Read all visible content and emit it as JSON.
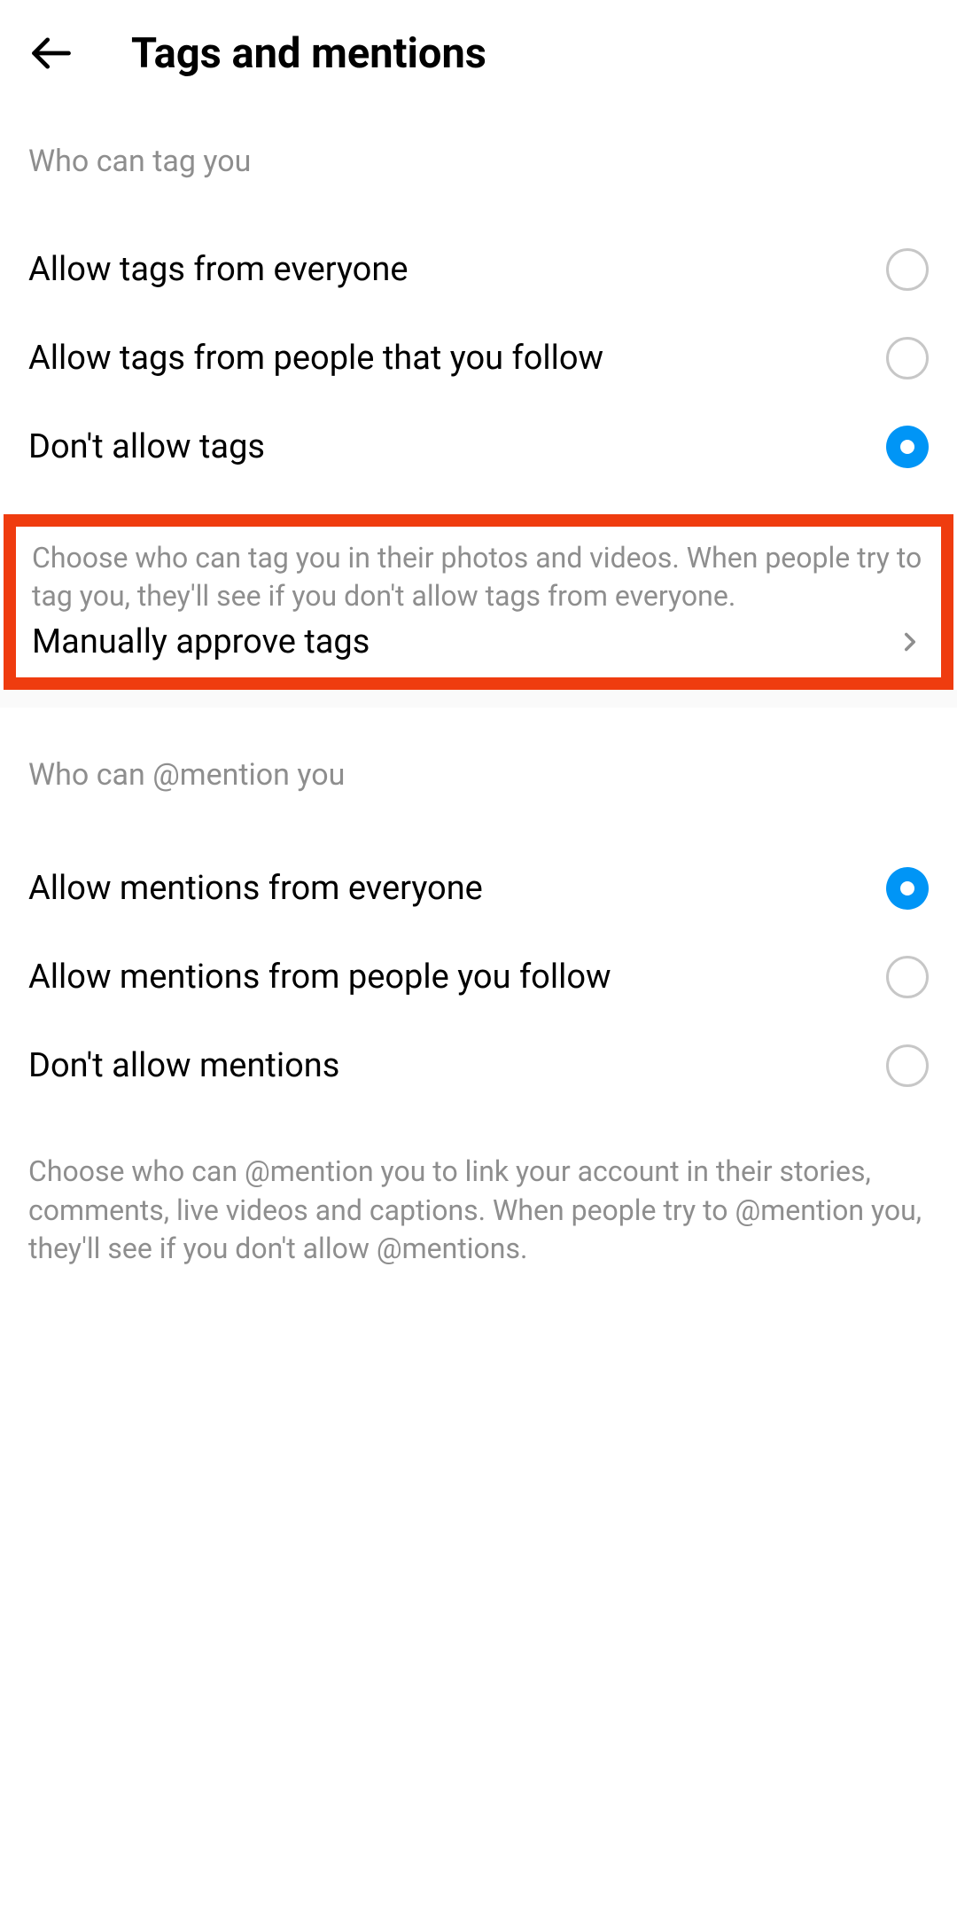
{
  "header": {
    "title": "Tags and mentions"
  },
  "tags_section": {
    "header": "Who can tag you",
    "options": [
      {
        "label": "Allow tags from everyone",
        "selected": false
      },
      {
        "label": "Allow tags from people that you follow",
        "selected": false
      },
      {
        "label": "Don't allow tags",
        "selected": true
      }
    ],
    "description": "Choose who can tag you in their photos and videos. When people try to tag you, they'll see if you don't allow tags from everyone.",
    "manual_approve_label": "Manually approve tags"
  },
  "mentions_section": {
    "header": "Who can @mention you",
    "options": [
      {
        "label": "Allow mentions from everyone",
        "selected": true
      },
      {
        "label": "Allow mentions from people you follow",
        "selected": false
      },
      {
        "label": "Don't allow mentions",
        "selected": false
      }
    ],
    "description": "Choose who can @mention you to link your account in their stories, comments, live videos and captions. When people try to @mention you, they'll see if you don't allow @mentions."
  }
}
